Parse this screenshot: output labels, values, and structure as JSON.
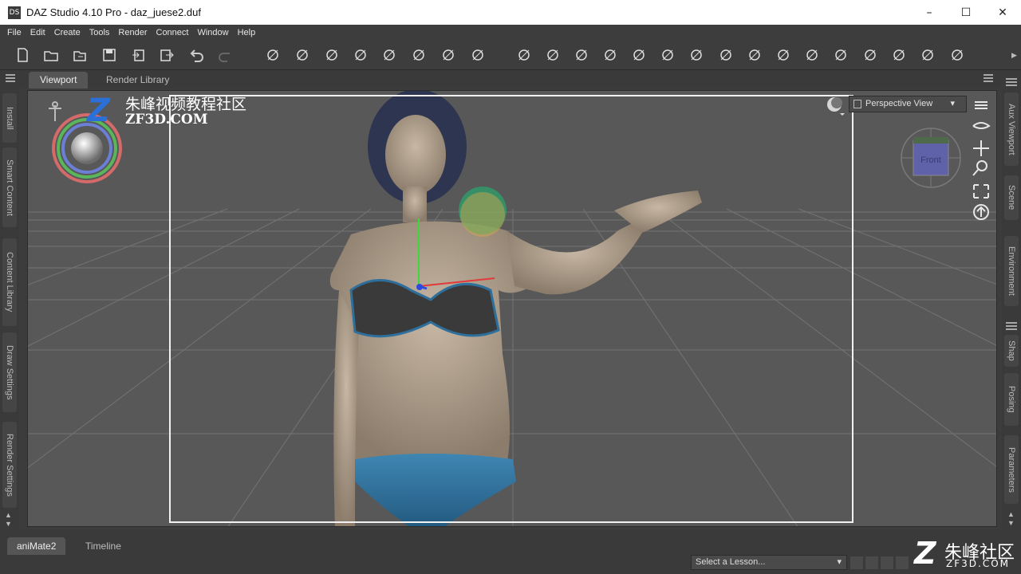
{
  "window": {
    "title": "DAZ Studio 4.10 Pro - daz_juese2.duf",
    "logo": "DS"
  },
  "menu": [
    "File",
    "Edit",
    "Create",
    "Tools",
    "Render",
    "Connect",
    "Window",
    "Help"
  ],
  "toolbar": {
    "icons": [
      "new-file-icon",
      "open-file-icon",
      "merge-file-icon",
      "save-icon",
      "import-icon",
      "export-icon",
      "undo-icon",
      "redo-icon",
      "create-camera-icon",
      "create-light-icon",
      "spot-light-icon",
      "point-light-icon",
      "distant-light-icon",
      "node-weight-icon",
      "geometry-editor-icon",
      "joint-editor-icon",
      "render-grid-icon",
      "universal-tool-icon",
      "select-tool-icon",
      "rotate-tool-icon",
      "rotate-icon",
      "translate-icon",
      "scale-icon",
      "active-pose-icon",
      "figure-icon",
      "morph-icon",
      "figure-setup-icon",
      "camera-icon",
      "pointer-tool-icon",
      "node-icon",
      "render-settings-icon",
      "render-icon"
    ]
  },
  "tabs": {
    "viewport": "Viewport",
    "render_library": "Render Library"
  },
  "left_rail": [
    "Install",
    "Smart Content",
    "Content Library",
    "Draw Settings",
    "Render Settings"
  ],
  "right_rail": [
    "Aux Viewport",
    "Scene",
    "Environment",
    "Shap",
    "Posing",
    "Parameters"
  ],
  "viewport": {
    "camera": "Perspective View",
    "cube_label": "Front"
  },
  "watermark": {
    "cn": "朱峰视频教程社区",
    "en": "ZF3D.COM",
    "corner_cn": "朱峰社区",
    "corner_en": "ZF3D.COM"
  },
  "bottom": {
    "tab1": "aniMate2",
    "tab2": "Timeline",
    "lesson_placeholder": "Select a Lesson..."
  },
  "colors": {
    "background": "#3c3c3c",
    "viewport": "#585858",
    "accent": "#f2f2f2"
  }
}
